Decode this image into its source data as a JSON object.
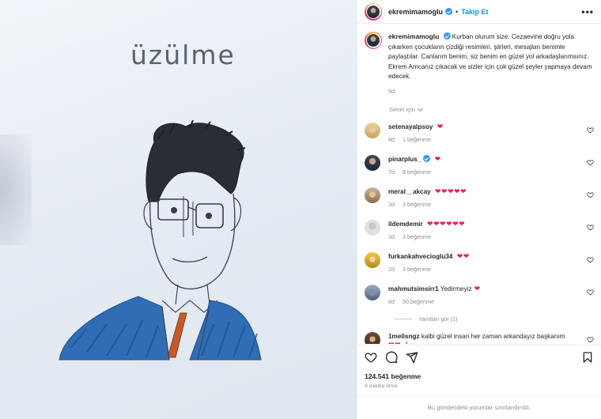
{
  "post": {
    "image_caption_text": "üzülme",
    "header": {
      "username": "ekremimamoglu",
      "separator": "•",
      "follow_label": "Takip Et",
      "more_label": "•••"
    },
    "caption": {
      "username": "ekremimamoglu",
      "text": "Kurban olurum size. Cezaevine doğru yola çıkarken çocukların çizdiği resimleri, şiirleri, mesajları benimle paylaştılar. Canlarım benim, siz benim en güzel yol arkadaşlarımsınız. Ekrem Amcanız çıkacak ve sizler için çok güzel şeyler yapmaya devam edecek.",
      "age": "9d"
    },
    "translate_label": "Senin için",
    "comments": [
      {
        "username": "setenayalpsoy",
        "verified": false,
        "text": "",
        "hearts": "❤",
        "age": "8d",
        "likes": "1 beğenme",
        "avatar": "blond"
      },
      {
        "username": "pinarplus_",
        "verified": true,
        "text": "",
        "hearts": "❤",
        "age": "7d",
        "likes": "8 beğenme",
        "avatar": "man"
      },
      {
        "username": "meral__akcay",
        "verified": false,
        "text": "",
        "hearts": "❤❤❤❤❤",
        "age": "3d",
        "likes": "3 beğenme",
        "avatar": "woman"
      },
      {
        "username": "ildemdemir",
        "verified": false,
        "text": "",
        "hearts": "❤❤❤❤❤❤",
        "age": "3d",
        "likes": "3 beğenme",
        "avatar": "gray"
      },
      {
        "username": "furkankahvecioglu34",
        "verified": false,
        "text": "",
        "hearts": "❤❤",
        "age": "2d",
        "likes": "3 beğenme",
        "avatar": "yellow"
      },
      {
        "username": "mahmutsimsirr1",
        "verified": false,
        "text": "Yedirmeyiz",
        "hearts": "❤",
        "age": "8d",
        "likes": "50 beğenme",
        "avatar": "car"
      }
    ],
    "replies_label": "Yanıtları gör (1)",
    "last_comment": {
      "username": "1melisngz",
      "text": "kalbi güzel insan her zaman arkandayız başkanım",
      "hearts": "❤❤",
      "extra": "🙏",
      "avatar": "curly"
    },
    "likes_count": "124.541 beğenme",
    "posted_time": "9 dakika önce",
    "comments_limited_note": "Bu gönderideki yorumlar sınırlandırıldı."
  },
  "colors": {
    "accent": "#0095f6",
    "heart": "#e0245e",
    "verified": "#3897f0",
    "muted": "#8e8e8e"
  },
  "icons": [
    "heart-icon",
    "comment-icon",
    "share-icon",
    "bookmark-icon",
    "verified-icon",
    "more-icon",
    "chevron-down-icon"
  ]
}
